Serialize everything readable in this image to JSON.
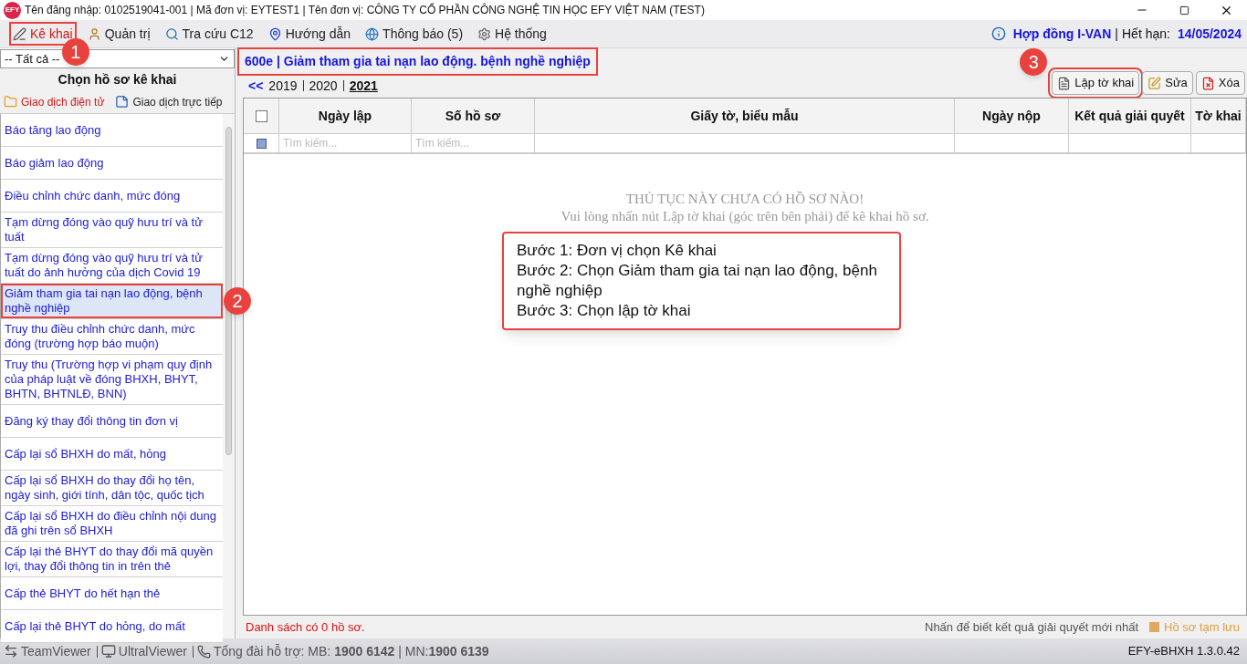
{
  "window": {
    "app_mark": "EFY",
    "title": "Tên đăng nhập: 0102519041-001 | Mã đơn vị: EYTEST1 | Tên đơn vị: CÔNG TY CỔ PHẦN CÔNG NGHỆ TIN HỌC EFY VIỆT NAM (TEST)"
  },
  "menu": {
    "items": [
      {
        "label": "Kê khai",
        "kind": "pen",
        "selected": true,
        "highlighted": true,
        "badge": "1"
      },
      {
        "label": "Quản trị",
        "kind": "user",
        "selected": false,
        "highlighted": false
      },
      {
        "label": "Tra cứu C12",
        "kind": "search",
        "selected": false,
        "highlighted": false
      },
      {
        "label": "Hướng dẫn",
        "kind": "pin",
        "selected": false,
        "highlighted": false
      },
      {
        "label": "Thông báo (5)",
        "kind": "globe",
        "selected": false,
        "highlighted": false
      },
      {
        "label": "Hệ thống",
        "kind": "gear",
        "selected": false,
        "highlighted": false
      }
    ],
    "contract": "Hợp đồng I-VAN",
    "separator": "|",
    "expiry_label": "Hết hạn:",
    "expiry": "14/05/2024"
  },
  "sidebar": {
    "filter": "-- Tất cả --",
    "heading": "Chọn hồ sơ kê khai",
    "tabs": [
      {
        "label": "Giao dịch điện tử",
        "kind": "folder",
        "selected": true
      },
      {
        "label": "Giao dịch trực tiếp",
        "kind": "note",
        "selected": false
      }
    ],
    "items": [
      {
        "label": "Báo tăng lao động",
        "selected": false,
        "highlighted": false
      },
      {
        "label": "Báo giảm lao động",
        "selected": false,
        "highlighted": false
      },
      {
        "label": "Điều chỉnh chức danh, mức đóng",
        "selected": false,
        "highlighted": false
      },
      {
        "label": "Tạm dừng đóng vào quỹ hưu trí và tử tuất",
        "selected": false,
        "highlighted": false
      },
      {
        "label": "Tạm dừng đóng vào quỹ hưu trí và tử tuất do ảnh hưởng của dịch Covid 19",
        "selected": false,
        "highlighted": false
      },
      {
        "label": "Giảm tham gia tai nạn lao động, bệnh nghề nghiệp",
        "selected": true,
        "highlighted": true,
        "badge": "2"
      },
      {
        "label": "Truy thu điều chỉnh chức danh, mức đóng (trường hợp báo muộn)",
        "selected": false,
        "highlighted": false
      },
      {
        "label": "Truy thu (Trường hợp vi phạm quy định của pháp luật về đóng BHXH, BHYT, BHTN, BHTNLĐ, BNN)",
        "selected": false,
        "highlighted": false
      },
      {
        "label": "Đăng ký thay đổi thông tin đơn vị",
        "selected": false,
        "highlighted": false
      },
      {
        "label": "Cấp lại sổ BHXH do mất, hỏng",
        "selected": false,
        "highlighted": false
      },
      {
        "label": "Cấp lại sổ BHXH do thay đổi họ tên, ngày sinh, giới tính, dân tộc, quốc tịch",
        "selected": false,
        "highlighted": false
      },
      {
        "label": "Cấp lại sổ BHXH do điều chỉnh nội dung đã ghi trên sổ BHXH",
        "selected": false,
        "highlighted": false
      },
      {
        "label": "Cấp lại thẻ BHYT do thay đổi mã quyền lợi, thay đổi thông tin in trên thẻ",
        "selected": false,
        "highlighted": false
      },
      {
        "label": "Cấp thẻ BHYT do hết hạn thẻ",
        "selected": false,
        "highlighted": false
      },
      {
        "label": "Cấp lại thẻ BHYT do hỏng, do mất",
        "selected": false,
        "highlighted": false
      }
    ]
  },
  "main": {
    "title": "600e | Giảm tham gia tai nạn lao động. bệnh nghề nghiệp",
    "title_highlighted": true,
    "back": "<<",
    "years": [
      {
        "label": "2019",
        "selected": false
      },
      {
        "label": "2020",
        "selected": false
      },
      {
        "label": "2021",
        "selected": true
      }
    ],
    "buttons": [
      {
        "label": "Lập tờ khai",
        "kind": "doc",
        "highlighted": true,
        "badge": "3"
      },
      {
        "label": "Sửa",
        "kind": "edit",
        "highlighted": false
      },
      {
        "label": "Xóa",
        "kind": "delete",
        "highlighted": false
      }
    ],
    "table": {
      "select_all_checked": false,
      "columns": [
        "Ngày lập",
        "Số hồ sơ",
        "Giấy tờ, biểu mẫu",
        "Ngày nộp",
        "Kết quả giải quyết",
        "Tờ khai"
      ],
      "search_placeholders": [
        "Tìm kiếm...",
        "Tìm kiếm..."
      ],
      "empty_title": "THỦ TỤC NÀY CHƯA CÓ HỒ SƠ NÀO!",
      "empty_hint": "Vui lòng nhấn nút Lập tờ khai (góc trên bên phải) để kê khai hồ sơ."
    },
    "callout": [
      "Bước 1: Đơn vị chọn Kê khai",
      "Bước 2: Chọn Giảm tham gia tai nạn lao động, bệnh nghề nghiệp",
      "Bước 3: Chọn lập tờ khai"
    ],
    "count": "Danh sách có 0 hồ sơ.",
    "hint": "Nhấn để biết kết quả giải quyết mới nhất",
    "legend": "Hồ sơ tạm lưu"
  },
  "status_bar": {
    "items": [
      {
        "label": "TeamViewer",
        "kind": "teamviewer"
      },
      {
        "label": "UltralViewer",
        "kind": "monitor"
      }
    ],
    "support": "Tổng đài hỗ trợ: MB: **1900 6142** | MN:**1900 6139**",
    "version": "EFY-eBHXH 1.3.0.42"
  }
}
